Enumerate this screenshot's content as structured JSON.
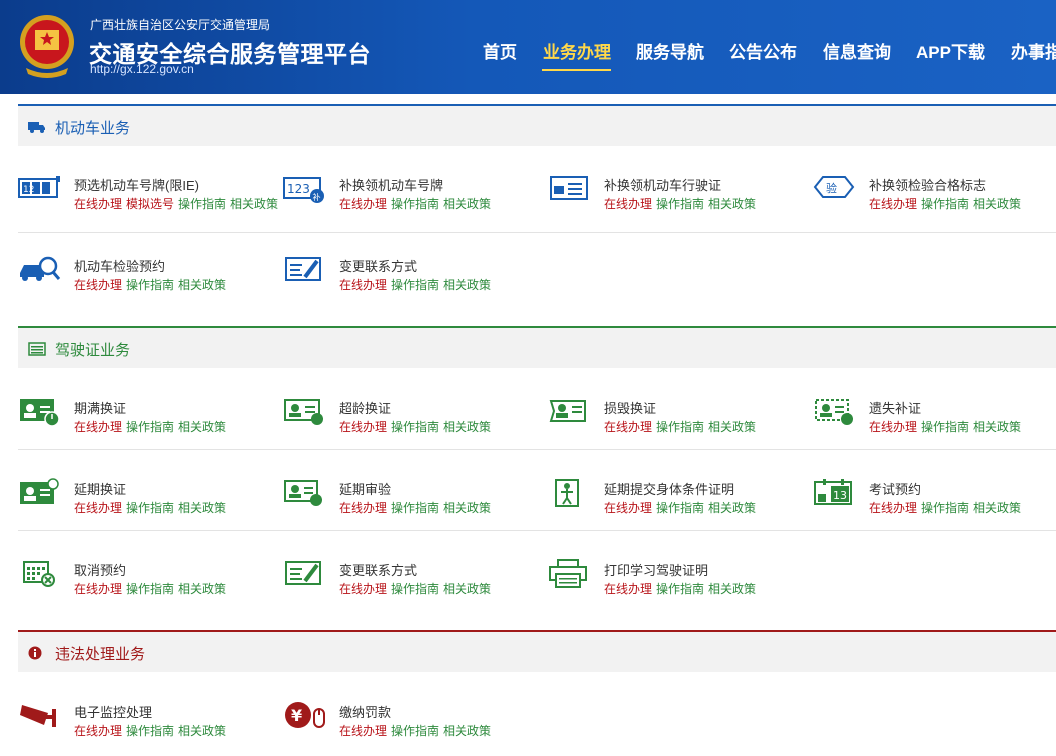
{
  "header": {
    "org": "广西壮族自治区公安厅交通管理局",
    "title": "交通安全综合服务管理平台",
    "url": "http://gx.122.gov.cn"
  },
  "nav": [
    "首页",
    "业务办理",
    "服务导航",
    "公告公布",
    "信息查询",
    "APP下载",
    "办事指"
  ],
  "links": {
    "online": "在线办理",
    "mock": "模拟选号",
    "guide": "操作指南",
    "policy": "相关政策"
  },
  "sections": {
    "vehicle": {
      "title": "机动车业务",
      "items": [
        "预选机动车号牌(限IE)",
        "补换领机动车号牌",
        "补换领机动车行驶证",
        "补换领检验合格标志",
        "机动车检验预约",
        "变更联系方式"
      ]
    },
    "license": {
      "title": "驾驶证业务",
      "items": [
        "期满换证",
        "超龄换证",
        "损毁换证",
        "遗失补证",
        "延期换证",
        "延期审验",
        "延期提交身体条件证明",
        "考试预约",
        "取消预约",
        "变更联系方式",
        "打印学习驾驶证明"
      ]
    },
    "violation": {
      "title": "违法处理业务",
      "items": [
        "电子监控处理",
        "缴纳罚款"
      ]
    }
  },
  "icon_text": {
    "plate_digits": "123",
    "plate_digits_short": "12",
    "bu": "补",
    "yan": "验",
    "calendar_day": "13"
  },
  "colors": {
    "vehicle": "#1a5fb4",
    "license": "#2e8a3d",
    "violation": "#a01a1a",
    "link_red": "#b8141a",
    "link_green": "#2e8a3d"
  }
}
